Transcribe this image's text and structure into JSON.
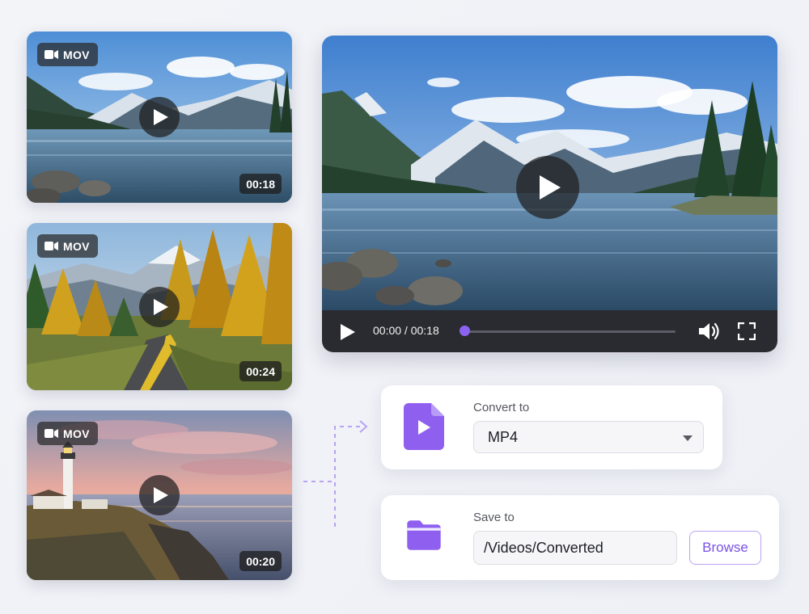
{
  "thumbnails": [
    {
      "format": "MOV",
      "duration": "00:18",
      "scene": "mountain lake"
    },
    {
      "format": "MOV",
      "duration": "00:24",
      "scene": "autumn road"
    },
    {
      "format": "MOV",
      "duration": "00:20",
      "scene": "lighthouse sunset"
    }
  ],
  "player": {
    "time_display": "00:00 / 00:18",
    "progress": 0
  },
  "convert": {
    "label": "Convert to",
    "selected_format": "MP4"
  },
  "save": {
    "label": "Save to",
    "path": "/Videos/Converted",
    "browse_label": "Browse"
  },
  "icons": {
    "format_badge": "video-camera-icon",
    "play": "play-icon",
    "volume": "volume-icon",
    "fullscreen": "fullscreen-icon",
    "file": "video-file-icon",
    "folder": "folder-icon",
    "dropdown": "chevron-down-icon"
  },
  "colors": {
    "accent": "#8a63f0",
    "icon_purple": "#8f5ff0",
    "control_bar": "#2a2b30"
  }
}
